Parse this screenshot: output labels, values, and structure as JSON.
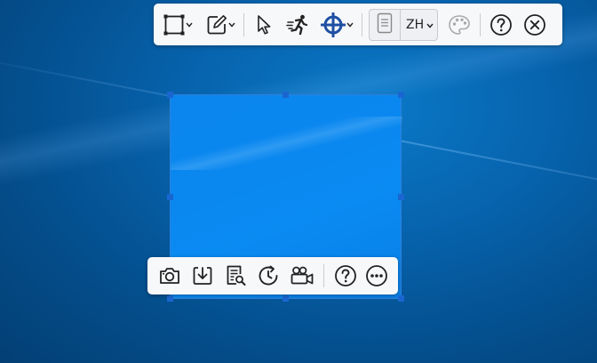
{
  "top_toolbar": {
    "tools": [
      {
        "id": "rectangle",
        "icon": "rectangle-select-icon",
        "has_dropdown": true
      },
      {
        "id": "annotate",
        "icon": "edit-square-icon",
        "has_dropdown": true
      },
      {
        "id": "pointer",
        "icon": "cursor-arrow-icon",
        "has_dropdown": false
      },
      {
        "id": "auto-run",
        "icon": "running-man-icon",
        "has_dropdown": false
      },
      {
        "id": "crosshair",
        "icon": "crosshair-icon",
        "has_dropdown": true
      }
    ],
    "language_selector": {
      "document_icon": "document-icon",
      "value": "ZH"
    },
    "palette_icon": "palette-icon",
    "help_icon": "help-circle-icon",
    "close_icon": "close-circle-icon",
    "accent_color": "#1f4fa3"
  },
  "bottom_toolbar": {
    "tools": [
      {
        "id": "capture",
        "icon": "camera-icon"
      },
      {
        "id": "save",
        "icon": "download-icon"
      },
      {
        "id": "ocr",
        "icon": "document-search-icon"
      },
      {
        "id": "delay",
        "icon": "timer-icon"
      },
      {
        "id": "record",
        "icon": "video-camera-icon"
      },
      {
        "id": "help",
        "icon": "help-circle-icon"
      },
      {
        "id": "more",
        "icon": "more-icon"
      }
    ]
  },
  "selection": {
    "fill_color": "#0a88f0",
    "handle_color": "#1a66d1"
  },
  "desktop": {
    "background_color": "#0763ad"
  }
}
